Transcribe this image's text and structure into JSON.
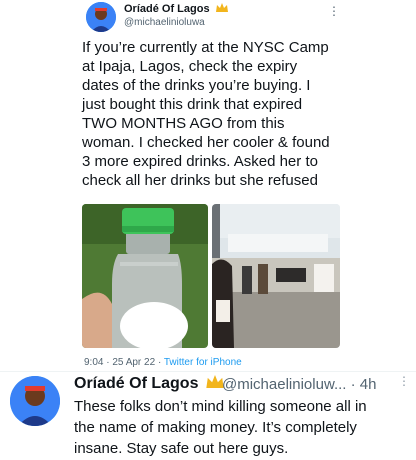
{
  "tweet": {
    "author_name": "Oríadé Of Lagos",
    "author_handle": "@michaelinioluwa",
    "more": "⋮",
    "text": "If you’re currently at the NYSC Camp\nat Ipaja, Lagos, check the expiry\ndates of the drinks you’re buying. I\njust bought this drink that expired\nTWO MONTHS AGO from this\nwoman. I checked her cooler & found\n3 more expired drinks. Asked her to\ncheck all her drinks but she refused",
    "timestamp": "9:04 · 25 Apr 22 · ",
    "source": "Twitter for iPhone"
  },
  "reply": {
    "author_name": "Oríadé Of Lagos",
    "author_handle": "@michaelinioluw... · 4h",
    "more": "⋮",
    "text": "These folks don’t mind killing someone all in\nthe name of making money. It’s completely\ninsane. Stay safe out here guys."
  },
  "colors": {
    "accent": "#1d9bf0",
    "muted": "#536471",
    "crown": "#f2b51d"
  },
  "icons": {
    "crown": "crown-icon",
    "more": "more-icon"
  }
}
